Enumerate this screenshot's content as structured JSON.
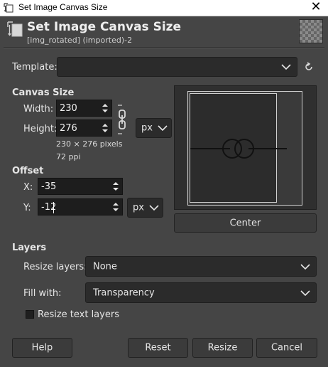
{
  "window": {
    "title": "Set Image Canvas Size",
    "close_label": "✕"
  },
  "header": {
    "title": "Set Image Canvas Size",
    "subtitle": "[img_rotated] (imported)-2"
  },
  "template": {
    "label": "Template:",
    "value": ""
  },
  "canvas_size": {
    "section_label": "Canvas Size",
    "width_label": "Width:",
    "width_value": "230",
    "height_label": "Height:",
    "height_value": "276",
    "unit": "px",
    "info_pixels": "230 × 276 pixels",
    "info_ppi": "72 ppi"
  },
  "offset": {
    "section_label": "Offset",
    "x_label": "X:",
    "x_value": "-35",
    "y_label": "Y:",
    "y_value": "-12",
    "unit": "px"
  },
  "center_button": "Center",
  "layers": {
    "section_label": "Layers",
    "resize_label": "Resize layers:",
    "resize_value": "None",
    "fill_label": "Fill with:",
    "fill_value": "Transparency",
    "resize_text_label": "Resize text layers",
    "resize_text_checked": false
  },
  "buttons": {
    "help": "Help",
    "reset": "Reset",
    "resize": "Resize",
    "cancel": "Cancel"
  },
  "icons": {
    "app": "canvas-size-icon",
    "header": "canvas-size-icon",
    "reset": "reset-icon",
    "chain": "chain-link-icon",
    "chevron": "chevron-down-icon",
    "spin": "spin-arrows-icon"
  }
}
